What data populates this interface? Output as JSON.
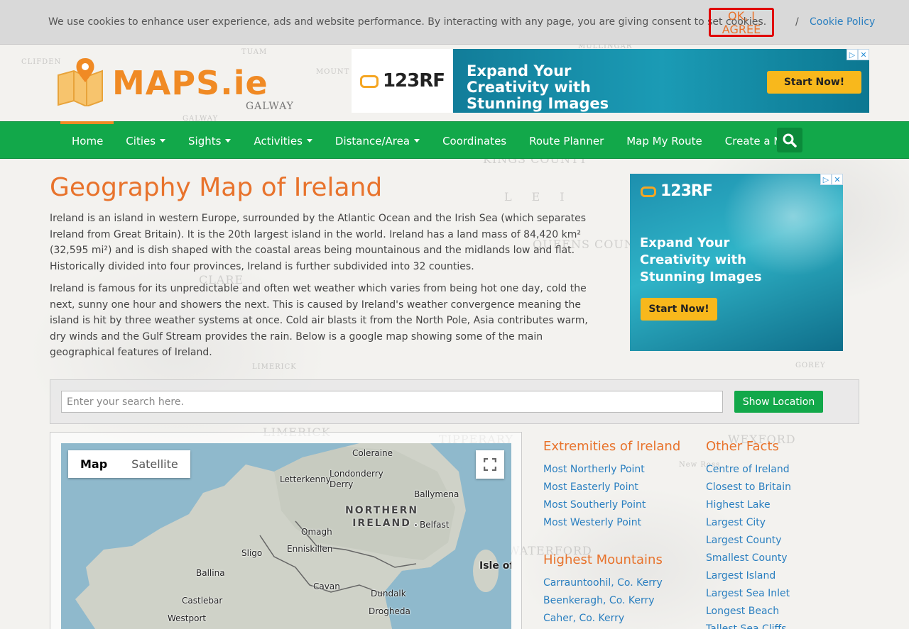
{
  "cookie": {
    "text": "We use cookies to enhance user experience, ads and website performance. By interacting with any page, you are giving consent to set cookies.",
    "agree_label": "OK, I AGREE",
    "separator": "/",
    "policy_label": "Cookie Policy"
  },
  "logo": {
    "name": "MAPS.ie",
    "sub": "GALWAY"
  },
  "ad_top": {
    "brand": "123RF",
    "headline": "Expand Your Creativity with Stunning Images",
    "cta": "Start Now!",
    "adchoices": "▷",
    "close": "✕"
  },
  "nav": {
    "items": [
      {
        "label": "Home",
        "dropdown": false
      },
      {
        "label": "Cities",
        "dropdown": true
      },
      {
        "label": "Sights",
        "dropdown": true
      },
      {
        "label": "Activities",
        "dropdown": true
      },
      {
        "label": "Distance/Area",
        "dropdown": true
      },
      {
        "label": "Coordinates",
        "dropdown": false
      },
      {
        "label": "Route Planner",
        "dropdown": false
      },
      {
        "label": "Map My Route",
        "dropdown": false
      },
      {
        "label": "Create a Map",
        "dropdown": false
      }
    ],
    "search_icon": "search-icon"
  },
  "main": {
    "title": "Geography Map of Ireland",
    "paragraph1": "Ireland is an island in western Europe, surrounded by the Atlantic Ocean and the Irish Sea (which separates Ireland from Great Britain). It is the 20th largest island in the world. Ireland has a land mass of 84,420 km² (32,595 mi²) and is dish shaped with the coastal areas being mountainous and the midlands low and flat. Historically divided into four provinces, Ireland is further subdivided into 32 counties.",
    "paragraph2": "Ireland is famous for its unpredictable and often wet weather which varies from being hot one day, cold the next, sunny one hour and showers the next. This is caused by Ireland's weather convergence meaning the island is hit by three weather systems at once. Cold air blasts it from the North Pole, Asia contributes warm, dry winds and the Gulf Stream provides the rain. Below is a google map showing some of the main geographical features of Ireland."
  },
  "ad_side": {
    "brand": "123RF",
    "headline": "Expand Your Creativity with Stunning Images",
    "cta": "Start Now!",
    "adchoices": "▷",
    "close": "✕"
  },
  "search": {
    "placeholder": "Enter your search here.",
    "button_label": "Show Location"
  },
  "map": {
    "tabs": [
      "Map",
      "Satellite"
    ],
    "active_tab": "Map",
    "labels": {
      "coleraine": "Coleraine",
      "londonderry": "Londonderry",
      "derry": "Derry",
      "letterkenny": "Letterkenny",
      "ballymena": "Ballymena",
      "northern_ireland_1": "NORTHERN",
      "northern_ireland_2": "IRELAND",
      "omagh": "Omagh",
      "belfast": "Belfast",
      "sligo": "Sligo",
      "enniskillen": "Enniskillen",
      "isle_of_man": "Isle of",
      "ballina": "Ballina",
      "cavan": "Cavan",
      "castlebar": "Castlebar",
      "dundalk": "Dundalk",
      "westport": "Westport",
      "drogheda": "Drogheda"
    }
  },
  "extremities": {
    "heading": "Extremities of Ireland",
    "links": [
      "Most Northerly Point",
      "Most Easterly Point",
      "Most Southerly Point",
      "Most Westerly Point"
    ]
  },
  "mountains": {
    "heading": "Highest Mountains",
    "links": [
      "Carrauntoohil, Co. Kerry",
      "Beenkeragh, Co. Kerry",
      "Caher, Co. Kerry"
    ]
  },
  "other_facts": {
    "heading": "Other Facts",
    "links": [
      "Centre of Ireland",
      "Closest to Britain",
      "Highest Lake",
      "Largest City",
      "Largest County",
      "Smallest County",
      "Largest Island",
      "Largest Sea Inlet",
      "Longest Beach",
      "Tallest Sea Cliffs"
    ]
  },
  "colors": {
    "accent_orange": "#e8732c",
    "nav_green": "#12a84a",
    "link_blue": "#2a7fc0",
    "cookie_border": "#e00000"
  }
}
